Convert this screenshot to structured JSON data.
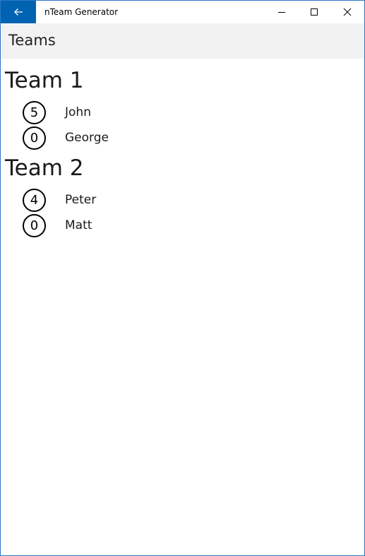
{
  "window": {
    "app_title": "nTeam Generator",
    "accent_color": "#0063b1",
    "icons": {
      "back": "arrow-left-icon",
      "minimize": "minimize-icon",
      "maximize": "maximize-icon",
      "close": "close-icon"
    }
  },
  "header": {
    "title": "Teams"
  },
  "teams": [
    {
      "name": "Team 1",
      "members": [
        {
          "score": "5",
          "name": "John"
        },
        {
          "score": "0",
          "name": "George"
        }
      ]
    },
    {
      "name": "Team 2",
      "members": [
        {
          "score": "4",
          "name": "Peter"
        },
        {
          "score": "0",
          "name": "Matt"
        }
      ]
    }
  ]
}
